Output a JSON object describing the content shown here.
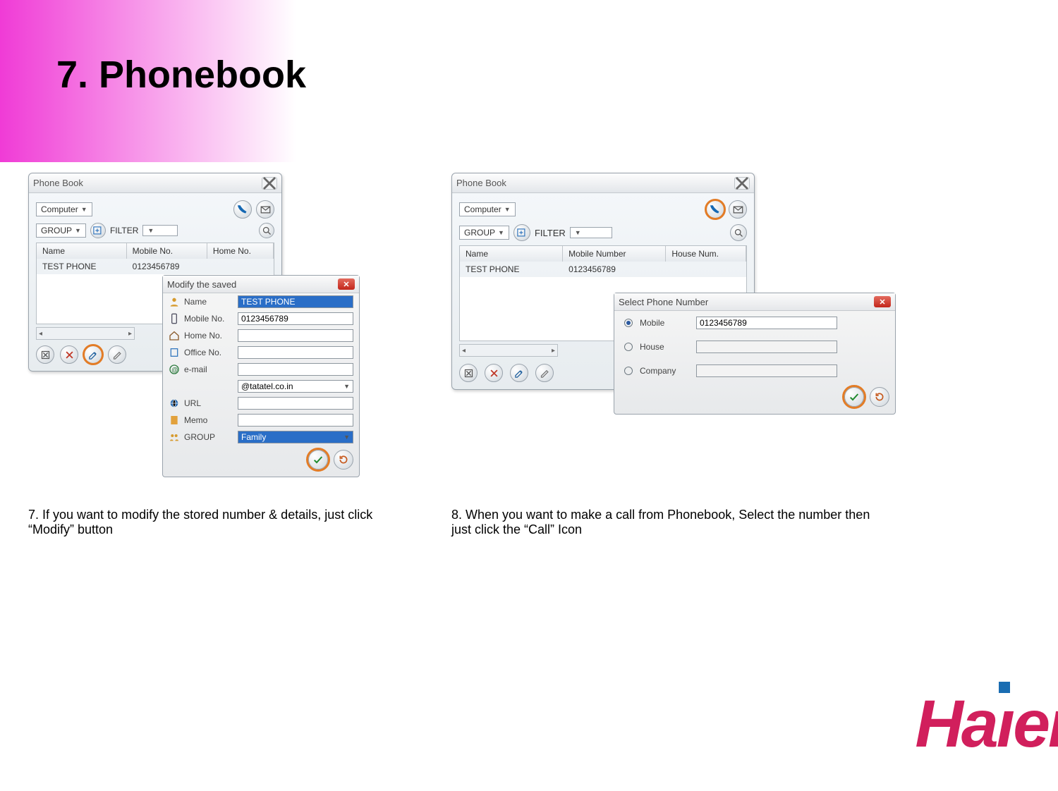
{
  "page_title": "7. Phonebook",
  "left_caption": "7. If you want to modify the stored number & details, just click “Modify” button",
  "right_caption": "8. When you want to make a call from Phonebook, Select the number then just click the “Call” Icon",
  "pb": {
    "title": "Phone Book",
    "source_select": "Computer",
    "group_label": "GROUP",
    "filter_label": "FILTER",
    "cols_short": {
      "c1": "Name",
      "c2": "Mobile No.",
      "c3": "Home No."
    },
    "cols_long": {
      "c1": "Name",
      "c2": "Mobile Number",
      "c3": "House Num."
    },
    "row": {
      "c1": "TEST PHONE",
      "c2": "0123456789"
    }
  },
  "modify_dlg": {
    "title": "Modify the saved",
    "fields": {
      "name": "Name",
      "name_val": "TEST PHONE",
      "mobile": "Mobile No.",
      "mobile_val": "0123456789",
      "home": "Home No.",
      "office": "Office No.",
      "email": "e-mail",
      "email_domain_val": "@tatatel.co.in",
      "url": "URL",
      "memo": "Memo",
      "group": "GROUP",
      "group_val": "Family"
    }
  },
  "select_dlg": {
    "title": "Select Phone Number",
    "mobile_label": "Mobile",
    "mobile_val": "0123456789",
    "house_label": "House",
    "company_label": "Company"
  },
  "logo": "Haier"
}
